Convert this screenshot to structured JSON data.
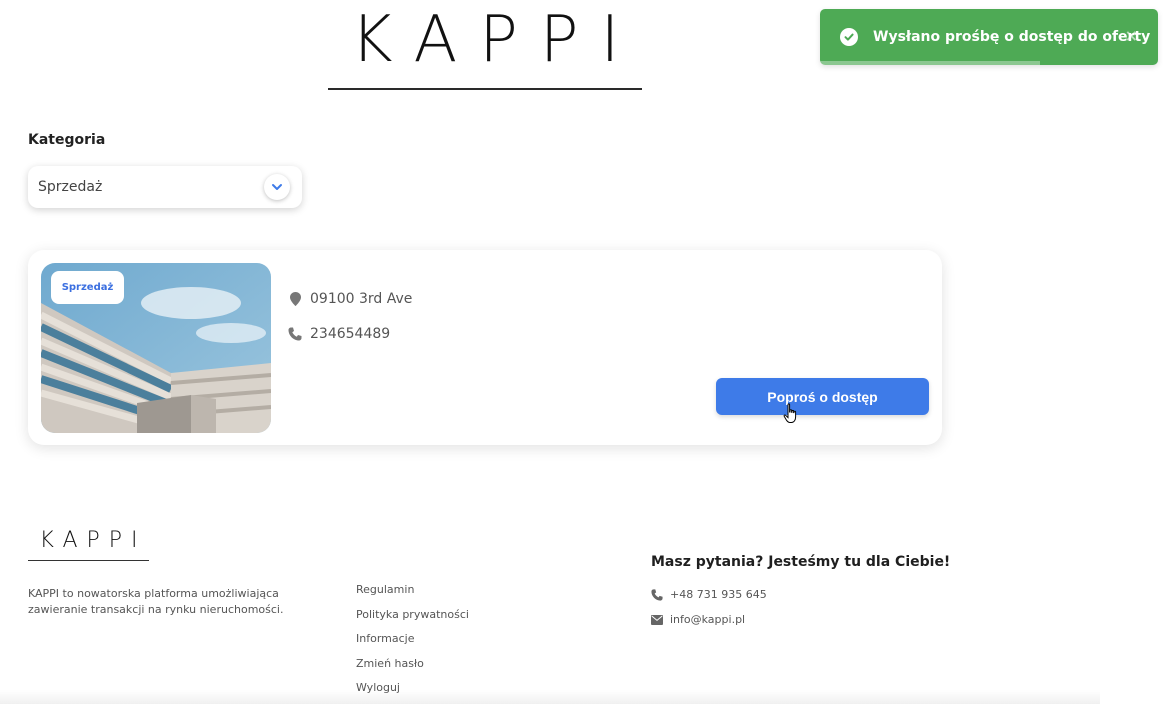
{
  "header": {
    "logo_text": "KAPPI"
  },
  "toast": {
    "message": "Wysłano prośbę o dostęp do oferty",
    "close_label": "×",
    "color": "#4eaa55",
    "progress": 0.65
  },
  "category": {
    "label": "Kategoria",
    "selected": "Sprzedaż"
  },
  "listing": {
    "badge": "Sprzedaż",
    "address": "09100 3rd Ave",
    "phone": "234654489",
    "button_label": "Poproś o dostęp",
    "accent": "#3e7be8"
  },
  "footer": {
    "logo_text": "KAPPI",
    "description": "KAPPI to nowatorska platforma umożliwiająca zawieranie transakcji na rynku nieruchomości.",
    "links": [
      "Regulamin",
      "Polityka prywatności",
      "Informacje",
      "Zmień hasło",
      "Wyloguj"
    ],
    "contact_title": "Masz pytania? Jesteśmy tu dla Ciebie!",
    "phone": "+48 731 935 645",
    "email": "info@kappi.pl"
  },
  "icons": [
    "check-circle-icon",
    "close-icon",
    "chevron-down-icon",
    "map-pin-icon",
    "phone-icon",
    "mail-icon",
    "hand-cursor-icon"
  ]
}
